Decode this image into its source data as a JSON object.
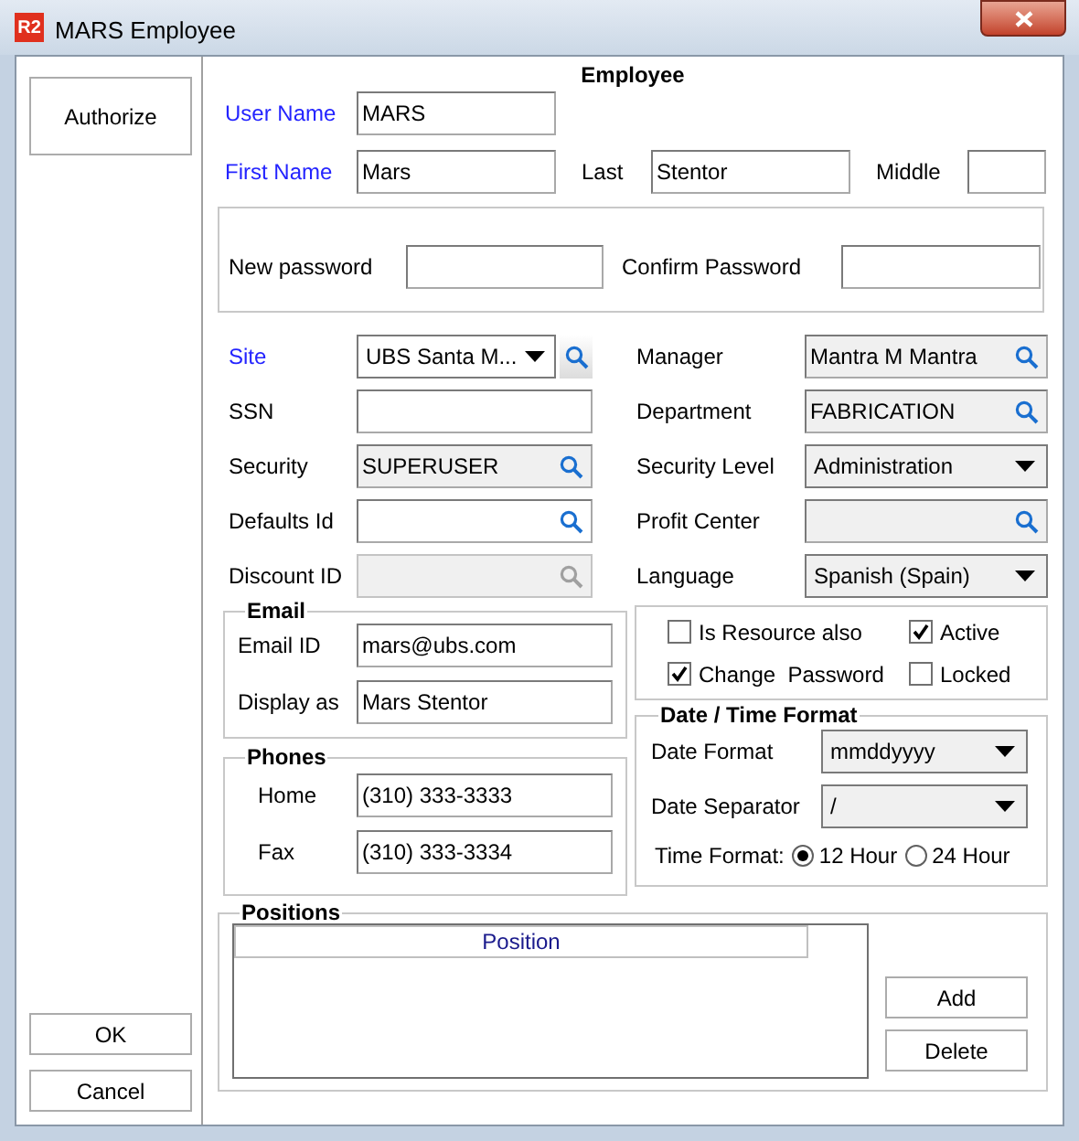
{
  "window": {
    "logo": "R2",
    "title": "MARS Employee"
  },
  "side_buttons": {
    "top": [
      {
        "label": "Authorize"
      }
    ],
    "bottom": [
      {
        "label": "OK"
      },
      {
        "label": "Cancel"
      }
    ]
  },
  "heading": "Employee",
  "user_name": {
    "label": "User Name",
    "value": "MARS",
    "required": true
  },
  "first_name": {
    "label": "First Name",
    "value": "Mars",
    "required": true
  },
  "last_name": {
    "label": "Last",
    "value": "Stentor",
    "required": false
  },
  "middle_name": {
    "label": "Middle",
    "required": false
  },
  "password": {
    "new_label": "New password",
    "confirm_label": "Confirm Password"
  },
  "left_fields": [
    {
      "label": "Site",
      "kind": "combo_lookup",
      "value": "UBS Santa M...",
      "required": true,
      "readonly": false,
      "disabled": false
    },
    {
      "label": "SSN",
      "kind": "text",
      "required": false,
      "readonly": false,
      "disabled": false
    },
    {
      "label": "Security",
      "kind": "lookup",
      "value": "SUPERUSER",
      "required": false,
      "readonly": true,
      "disabled": false
    },
    {
      "label": "Defaults Id",
      "kind": "lookup",
      "required": false,
      "readonly": false,
      "disabled": false
    },
    {
      "label": "Discount ID",
      "kind": "lookup",
      "required": false,
      "readonly": true,
      "disabled": true
    }
  ],
  "right_fields": [
    {
      "label": "Manager",
      "kind": "lookup",
      "value": "Mantra M Mantra",
      "readonly": true
    },
    {
      "label": "Department",
      "kind": "lookup",
      "value": "FABRICATION",
      "readonly": true
    },
    {
      "label": "Security Level",
      "kind": "combo",
      "value": "Administration",
      "readonly": true
    },
    {
      "label": "Profit  Center",
      "kind": "lookup",
      "readonly": true
    },
    {
      "label": "Language",
      "kind": "combo",
      "value": "Spanish (Spain)",
      "readonly": true
    }
  ],
  "email": {
    "title": "Email",
    "fields": [
      {
        "label": "Email ID",
        "value": "mars@ubs.com"
      },
      {
        "label": "Display as",
        "value": "Mars Stentor"
      }
    ]
  },
  "phones": {
    "title": "Phones",
    "fields": [
      {
        "label": "Home",
        "value": "(310) 333-3333"
      },
      {
        "label": "Fax",
        "value": "(310) 333-3334"
      }
    ]
  },
  "flags": [
    {
      "label": "Is Resource also",
      "checked": false
    },
    {
      "label": "Active",
      "checked": true
    },
    {
      "label": "Change  Password",
      "checked": true
    },
    {
      "label": "Locked",
      "checked": false
    }
  ],
  "date_time": {
    "title": "Date / Time Format",
    "combos": [
      {
        "label": "Date Format",
        "value": "mmddyyyy"
      },
      {
        "label": "Date Separator",
        "value": "/"
      }
    ],
    "time_format": {
      "label": "Time Format:",
      "options": [
        {
          "label": "12 Hour",
          "selected": true
        },
        {
          "label": "24 Hour",
          "selected": false
        }
      ]
    }
  },
  "positions": {
    "title": "Positions",
    "columns": [
      "Position"
    ],
    "buttons": [
      {
        "label": "Add"
      },
      {
        "label": "Delete"
      }
    ]
  }
}
